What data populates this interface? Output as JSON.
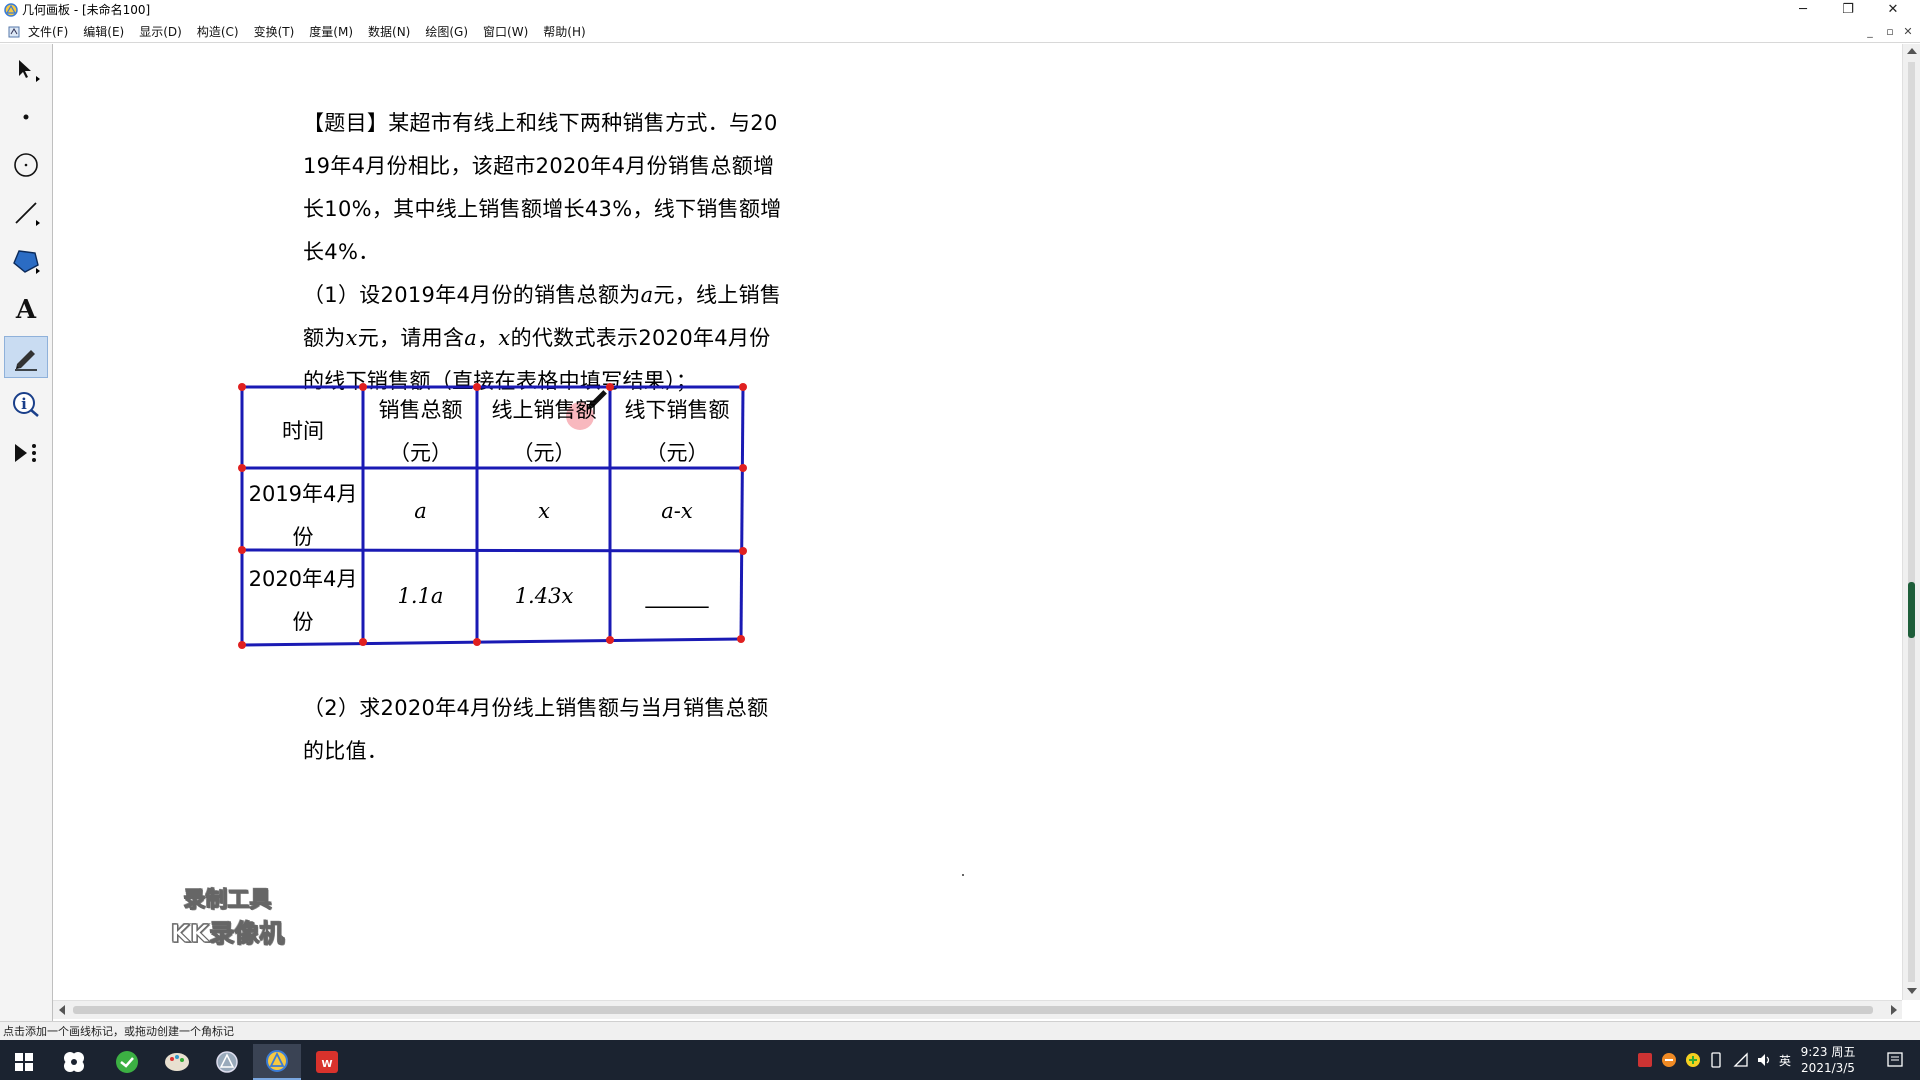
{
  "window": {
    "title": "几何画板 - [未命名100]",
    "minimize": "─",
    "restore": "❐",
    "close": "✕"
  },
  "menubar": {
    "items": [
      "文件(F)",
      "编辑(E)",
      "显示(D)",
      "构造(C)",
      "变换(T)",
      "度量(M)",
      "数据(N)",
      "绘图(G)",
      "窗口(W)",
      "帮助(H)"
    ],
    "mdi_minimize": "_",
    "mdi_restore": "▫",
    "mdi_close": "✕"
  },
  "toolbox": {
    "tools": [
      "arrow-select-tool",
      "point-tool",
      "compass-tool",
      "straightedge-tool",
      "polygon-tool",
      "text-tool",
      "marker-tool",
      "information-tool",
      "custom-tool"
    ],
    "active_tool": "marker-tool"
  },
  "problem": {
    "line1": "【题目】某超市有线上和线下两种销售方式．与20",
    "line2": "19年4月份相比，该超市2020年4月份销售总额增",
    "line3": "长10%，其中线上销售额增长43%，线下销售额增",
    "line4": "长4%．",
    "q1_line1_a": "（1）设2019年4月份的销售总额为",
    "q1_line1_var": "a",
    "q1_line1_b": "元，线上销售",
    "q1_line2_a": "额为",
    "q1_line2_var1": "x",
    "q1_line2_b": "元，请用含",
    "q1_line2_var2": "a",
    "q1_line2_c": "，",
    "q1_line2_var3": "x",
    "q1_line2_d": "的代数式表示2020年4月份",
    "q1_line3": "的线下销售额（直接在表格中填写结果）；",
    "q2_line1": "（2）求2020年4月份线上销售额与当月销售总额",
    "q2_line2": "的比值．"
  },
  "table": {
    "header_time": "时间",
    "header_total_1": "销售总额",
    "header_total_2": "（元）",
    "header_online_1": "线上销售额",
    "header_online_2": "（元）",
    "header_offline_1": "线下销售额",
    "header_offline_2": "（元）",
    "row1_time_1": "2019年4月",
    "row1_time_2": "份",
    "row1_total": "a",
    "row1_online": "x",
    "row1_offline": "a-x",
    "row2_time_1": "2020年4月",
    "row2_time_2": "份",
    "row2_total": "1.1a",
    "row2_online": "1.43x",
    "row2_offline_blank": "______"
  },
  "watermark": {
    "line1": "录制工具",
    "line2": "KK录像机"
  },
  "status": {
    "text": "点击添加一个画线标记，或拖动创建一个角标记"
  },
  "taskbar": {
    "clock_time": "9:23 周五",
    "clock_date": "2021/3/5",
    "ime": "英"
  },
  "colors": {
    "table_border": "#1a1ab4",
    "vertex_dot": "#e02020",
    "selection_blue": "#c9dcf2",
    "taskbar_bg": "#1b2330"
  }
}
